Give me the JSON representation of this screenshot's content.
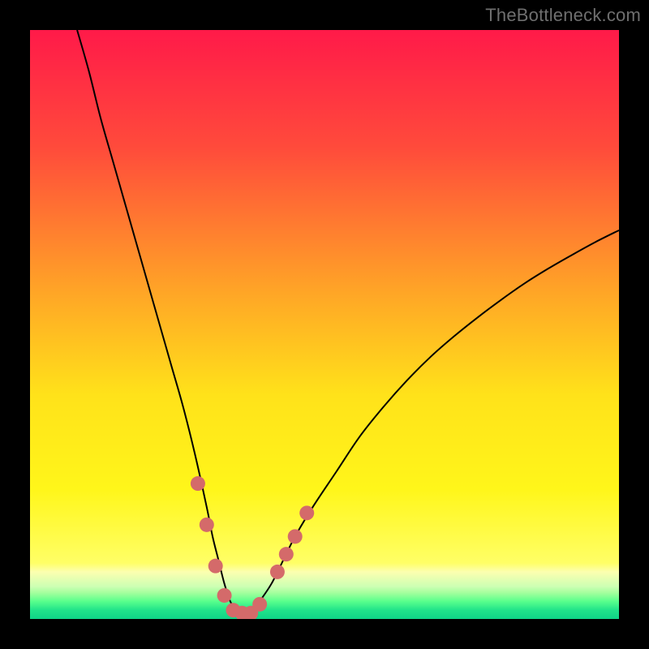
{
  "watermark": "TheBottleneck.com",
  "chart_data": {
    "type": "line",
    "title": "",
    "xlabel": "",
    "ylabel": "",
    "xlim": [
      0,
      100
    ],
    "ylim": [
      0,
      100
    ],
    "grid": false,
    "legend": false,
    "background_gradient": {
      "direction": "vertical",
      "stops": [
        {
          "t": 0.0,
          "color": "#ff1a49"
        },
        {
          "t": 0.2,
          "color": "#ff4b3b"
        },
        {
          "t": 0.45,
          "color": "#ffa726"
        },
        {
          "t": 0.62,
          "color": "#ffe21a"
        },
        {
          "t": 0.78,
          "color": "#fff61a"
        },
        {
          "t": 0.905,
          "color": "#ffff66"
        },
        {
          "t": 0.92,
          "color": "#fcffb0"
        },
        {
          "t": 0.945,
          "color": "#ccffb3"
        },
        {
          "t": 0.955,
          "color": "#a6ff9e"
        },
        {
          "t": 0.97,
          "color": "#59ff8c"
        },
        {
          "t": 0.985,
          "color": "#21e38a"
        },
        {
          "t": 1.0,
          "color": "#0fd487"
        }
      ]
    },
    "series": [
      {
        "name": "bottleneck-curve",
        "color": "#000000",
        "stroke_width": 2,
        "x": [
          8,
          10,
          12,
          14,
          16,
          18,
          20,
          22,
          24,
          26,
          28,
          30,
          31,
          32,
          33,
          34,
          35,
          36,
          37,
          38,
          39,
          41,
          43,
          45,
          48,
          52,
          56,
          60,
          64,
          68,
          72,
          76,
          80,
          84,
          88,
          92,
          96,
          100
        ],
        "y": [
          100,
          93,
          85,
          78,
          71,
          64,
          57,
          50,
          43,
          36,
          28,
          19,
          14,
          10,
          6,
          3,
          1.5,
          1,
          1,
          1.5,
          3,
          6,
          10,
          14,
          19,
          25,
          31,
          36,
          40.5,
          44.5,
          48,
          51.2,
          54.2,
          57,
          59.5,
          61.8,
          64,
          66
        ]
      }
    ],
    "markers": {
      "name": "highlighted-points",
      "color": "#d46a6a",
      "radius": 9,
      "points": [
        {
          "x": 28.5,
          "y": 23
        },
        {
          "x": 30,
          "y": 16
        },
        {
          "x": 31.5,
          "y": 9
        },
        {
          "x": 33,
          "y": 4
        },
        {
          "x": 34.5,
          "y": 1.5
        },
        {
          "x": 36,
          "y": 1
        },
        {
          "x": 37.5,
          "y": 1
        },
        {
          "x": 39,
          "y": 2.5
        },
        {
          "x": 42,
          "y": 8
        },
        {
          "x": 43.5,
          "y": 11
        },
        {
          "x": 45,
          "y": 14
        },
        {
          "x": 47,
          "y": 18
        }
      ]
    }
  }
}
